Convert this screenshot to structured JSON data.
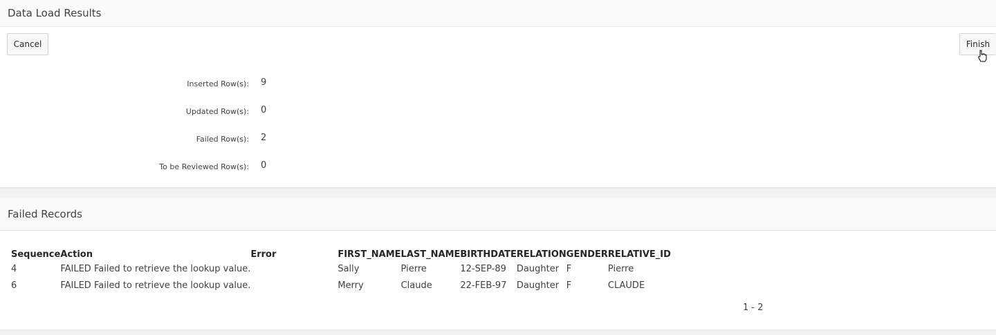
{
  "results": {
    "title": "Data Load Results",
    "cancel_label": "Cancel",
    "finish_label": "Finish",
    "stats": [
      {
        "label": "Inserted Row(s):",
        "value": "9"
      },
      {
        "label": "Updated Row(s):",
        "value": "0"
      },
      {
        "label": "Failed Row(s):",
        "value": "2"
      },
      {
        "label": "To be Reviewed Row(s):",
        "value": "0"
      }
    ]
  },
  "failed": {
    "title": "Failed Records",
    "columns": [
      "Sequence",
      "Action",
      "Error",
      "FIRST_NAME",
      "LAST_NAME",
      "BIRTHDATE",
      "RELATION",
      "GENDER",
      "RELATIVE_ID"
    ],
    "rows": [
      [
        "4",
        "FAILED",
        "Failed to retrieve the lookup value.",
        "Sally",
        "Pierre",
        "12-SEP-89",
        "Daughter",
        "F",
        "Pierre"
      ],
      [
        "6",
        "FAILED",
        "Failed to retrieve the lookup value.",
        "Merry",
        "Claude",
        "22-FEB-97",
        "Daughter",
        "F",
        "CLAUDE"
      ]
    ],
    "pagination": "1 - 2"
  }
}
